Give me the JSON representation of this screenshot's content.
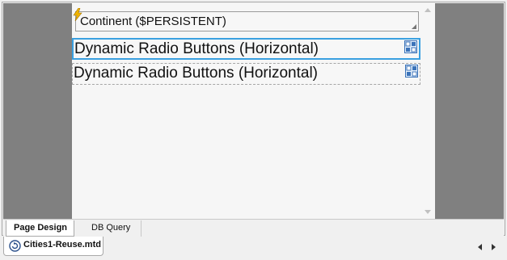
{
  "canvas": {
    "combo": {
      "label": "Continent ($PERSISTENT)",
      "icon": "lightning-bolt-icon"
    },
    "radio_controls": [
      {
        "label": "Dynamic Radio Buttons (Horizontal)",
        "icon": "radio-group-icon",
        "selected": true
      },
      {
        "label": "Dynamic Radio Buttons (Horizontal)",
        "icon": "radio-group-icon",
        "selected": false
      }
    ]
  },
  "view_tabs": [
    {
      "label": "Page Design",
      "active": true
    },
    {
      "label": "DB Query",
      "active": false
    }
  ],
  "document_tab": {
    "label": "Cities1-Reuse.mtd",
    "icon": "document-icon"
  },
  "colors": {
    "selection_border": "#3aa0e0",
    "workspace_gray": "#808080"
  }
}
